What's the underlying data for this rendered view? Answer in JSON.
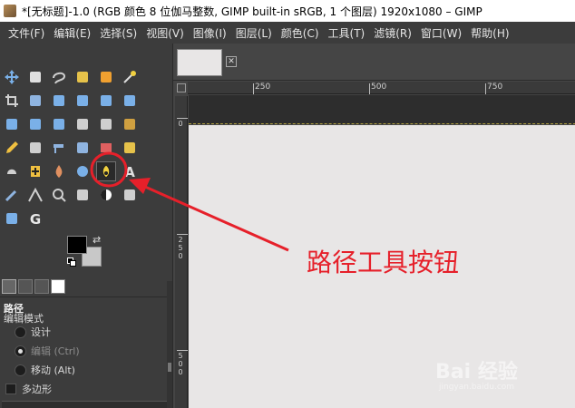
{
  "window": {
    "title": "*[无标题]-1.0 (RGB 颜色 8 位伽马整数, GIMP built-in sRGB, 1 个图层) 1920x1080 – GIMP"
  },
  "menu": [
    "文件(F)",
    "编辑(E)",
    "选择(S)",
    "视图(V)",
    "图像(I)",
    "图层(L)",
    "颜色(C)",
    "工具(T)",
    "滤镜(R)",
    "窗口(W)",
    "帮助(H)"
  ],
  "tools": [
    {
      "icon": "move-icon",
      "color": "#7ab0e8"
    },
    {
      "icon": "align-icon",
      "color": "#e0e0e0"
    },
    {
      "icon": "free-select-icon",
      "color": "#cfcfcf"
    },
    {
      "icon": "fuzzy-select-icon",
      "color": "#e6c24a"
    },
    {
      "icon": "select-by-color-icon",
      "color": "#f0a030"
    },
    {
      "icon": "magic-wand-icon",
      "color": "#f0d040"
    },
    {
      "icon": "crop-icon",
      "color": "#cfcfcf"
    },
    {
      "icon": "scissors-select-icon",
      "color": "#8fb4e0"
    },
    {
      "icon": "unified-transform-icon",
      "color": "#7ab0e8"
    },
    {
      "icon": "warp-transform-icon",
      "color": "#7ab0e8"
    },
    {
      "icon": "handle-transform-icon",
      "color": "#7ab0e8"
    },
    {
      "icon": "scale-icon",
      "color": "#7ab0e8"
    },
    {
      "icon": "rotate-icon",
      "color": "#7ab0e8"
    },
    {
      "icon": "perspective-icon",
      "color": "#7ab0e8"
    },
    {
      "icon": "cage-transform-icon",
      "color": "#7ab0e8"
    },
    {
      "icon": "flip-icon",
      "color": "#cfcfcf"
    },
    {
      "icon": "gradient-icon",
      "color": "#cfcfcf"
    },
    {
      "icon": "bucket-fill-icon",
      "color": "#d0a040"
    },
    {
      "icon": "pencil-icon",
      "color": "#f0c040"
    },
    {
      "icon": "paintbrush-icon",
      "color": "#cfcfcf"
    },
    {
      "icon": "airbrush-icon",
      "color": "#8fb4e0"
    },
    {
      "icon": "ink-icon",
      "color": "#8fb4e0"
    },
    {
      "icon": "eraser-icon",
      "color": "#e06060"
    },
    {
      "icon": "clone-icon",
      "color": "#e6c24a"
    },
    {
      "icon": "smudge-icon",
      "color": "#d0d0d0"
    },
    {
      "icon": "heal-icon",
      "color": "#f0c040"
    },
    {
      "icon": "blur-icon",
      "color": "#e09060"
    },
    {
      "icon": "dodge-burn-icon",
      "color": "#7ab0e8"
    },
    {
      "icon": "paths-icon",
      "color": "#f0d040"
    },
    {
      "icon": "text-icon",
      "color": "#e0e0e0"
    },
    {
      "icon": "color-picker-icon",
      "color": "#8fb4e0"
    },
    {
      "icon": "measure-icon",
      "color": "#cfcfcf"
    },
    {
      "icon": "zoom-icon",
      "color": "#cfcfcf"
    },
    {
      "icon": "foreground-select-icon",
      "color": "#cfcfcf"
    },
    {
      "icon": "threshold-icon",
      "color": "#7ab0e8"
    },
    {
      "icon": "levels-icon",
      "color": "#cfcfcf"
    },
    {
      "icon": "curves-icon",
      "color": "#7ab0e8"
    },
    {
      "icon": "gegl-icon",
      "color": "#e8e8e8"
    }
  ],
  "dock": {
    "tool_title": "路径",
    "mode_label": "编辑模式",
    "modes": [
      {
        "label": "设计",
        "checked": false,
        "dim": false
      },
      {
        "label": "编辑 (Ctrl)",
        "checked": true,
        "dim": true
      },
      {
        "label": "移动 (Alt)",
        "checked": false,
        "dim": false
      }
    ],
    "polygon_label": "多边形"
  },
  "ruler": {
    "h": [
      "250",
      "500",
      "750"
    ],
    "v": [
      "0",
      "250",
      "500"
    ]
  },
  "annotation": {
    "text": "路径工具按钮",
    "color": "#e6202a"
  },
  "watermark": {
    "main": "Bai 经验",
    "sub": "jingyan.baidu.com"
  }
}
